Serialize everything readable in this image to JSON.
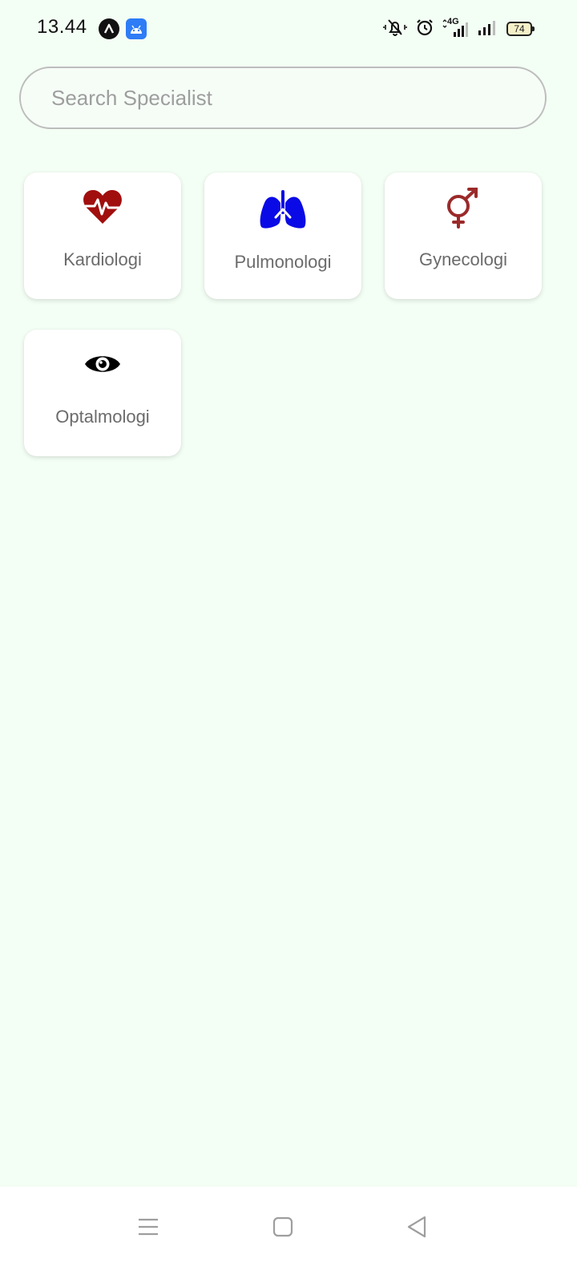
{
  "status_bar": {
    "time": "13.44",
    "battery_level": "74",
    "network_label": "4G"
  },
  "search": {
    "placeholder": "Search Specialist",
    "value": ""
  },
  "specialists": [
    {
      "label": "Kardiologi",
      "icon": "heart-pulse-icon",
      "color": "#a10e0e"
    },
    {
      "label": "Pulmonologi",
      "icon": "lungs-icon",
      "color": "#0a0ae6"
    },
    {
      "label": "Gynecologi",
      "icon": "venus-mars-icon",
      "color": "#9b2a2a"
    },
    {
      "label": "Optalmologi",
      "icon": "eye-icon",
      "color": "#000000"
    }
  ],
  "colors": {
    "background": "#f3fef4",
    "card": "#ffffff",
    "label_text": "#6b6b6b"
  },
  "nav": {
    "buttons": [
      "menu-icon",
      "home-icon",
      "back-icon"
    ]
  }
}
